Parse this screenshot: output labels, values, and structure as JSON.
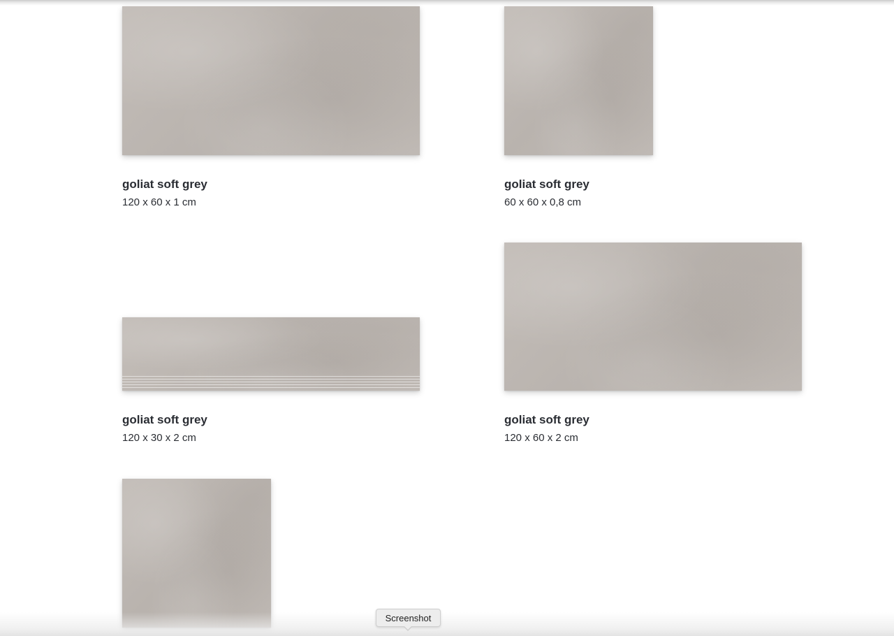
{
  "products": [
    {
      "title": "goliat soft grey",
      "size": "120 x 60 x 1 cm"
    },
    {
      "title": "goliat soft grey",
      "size": "60 x 60 x 0,8 cm"
    },
    {
      "title": "goliat soft grey",
      "size": "120 x 30 x 2 cm"
    },
    {
      "title": "goliat soft grey",
      "size": "120 x 60 x 2 cm"
    },
    {
      "title": "",
      "size": ""
    }
  ],
  "tooltip": {
    "label": "Screenshot"
  },
  "colors": {
    "tile": "#bdb7b2",
    "text": "#2a2d33",
    "background": "#ffffff"
  }
}
